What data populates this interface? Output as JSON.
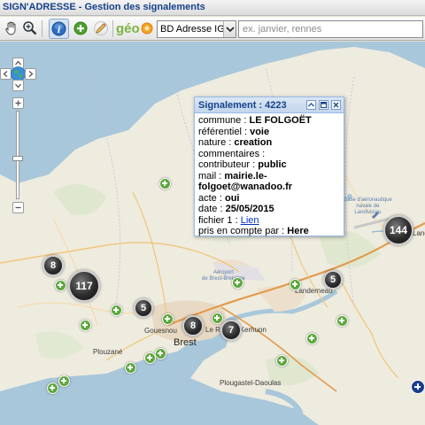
{
  "window": {
    "app_name": "SIGN'ADRESSE",
    "title_separator": " - ",
    "subtitle": "Gestion des signalements"
  },
  "toolbar": {
    "tools": [
      {
        "name": "pan-hand-icon",
        "active": false
      },
      {
        "name": "zoom-magnifier-icon",
        "active": false
      },
      {
        "name": "info-icon",
        "active": true
      },
      {
        "name": "add-report-icon",
        "active": false
      },
      {
        "name": "edit-pencil-icon",
        "active": false
      },
      {
        "name": "geo-logo",
        "active": false
      }
    ],
    "geo_logo_text": "géo",
    "layer_select": {
      "value": "BD Adresse IG"
    },
    "search": {
      "placeholder": "ex. janvier, rennes",
      "value": ""
    }
  },
  "map": {
    "labels": {
      "brest": "Brest",
      "landerneau": "Landerneau",
      "plouzane": "Plouzané",
      "gouesnou": "Gouesnou",
      "le_relecq": "Le Relecq-Kerhuon",
      "plougastel": "Plougastel-Daoulas",
      "airport": "Aéroport\nde Brest-Bretagne",
      "naval_base": "Base d'aéronautique\nnavale de\nLandivisiau",
      "landivisiau_edge": "Landivi"
    },
    "clusters": [
      {
        "count": "8",
        "name": "cluster-8-west"
      },
      {
        "count": "117",
        "name": "cluster-117"
      },
      {
        "count": "5",
        "name": "cluster-5-gouesnou"
      },
      {
        "count": "8",
        "name": "cluster-8-brest"
      },
      {
        "count": "7",
        "name": "cluster-7-relecq"
      },
      {
        "count": "5",
        "name": "cluster-5-landerneau"
      },
      {
        "count": "144",
        "name": "cluster-144"
      }
    ],
    "colors": {
      "sea": "#a8c7da",
      "land": "#eeebdf",
      "cluster": "#222222",
      "report_marker": "#5ea83d",
      "popup_border": "#99bbe8"
    }
  },
  "popup": {
    "title": "Signalement : 4223",
    "fields": [
      {
        "label": "commune",
        "sep": " : ",
        "value": "LE FOLGOËT"
      },
      {
        "label": "référentiel",
        "sep": " : ",
        "value": "voie"
      },
      {
        "label": "nature",
        "sep": " : ",
        "value": "creation"
      },
      {
        "label": "commentaires",
        "sep": " :",
        "value": ""
      },
      {
        "label": "contributeur",
        "sep": " : ",
        "value": "public"
      },
      {
        "label": "mail",
        "sep": " : ",
        "value": "mairie.le-"
      },
      {
        "label": "",
        "sep": "",
        "value": "folgoet@wanadoo.fr"
      },
      {
        "label": "acte",
        "sep": " : ",
        "value": "oui"
      },
      {
        "label": "date",
        "sep": " : ",
        "value": "25/05/2015"
      },
      {
        "label": "fichier 1",
        "sep": " : ",
        "value": "Lien",
        "link": true
      },
      {
        "label": "pris en compte par",
        "sep": " : ",
        "value": "Here"
      }
    ]
  }
}
